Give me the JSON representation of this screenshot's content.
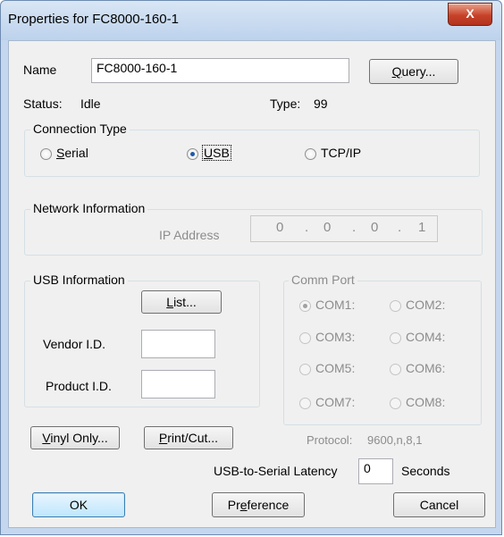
{
  "window": {
    "title": "Properties for FC8000-160-1",
    "close_label": "X"
  },
  "name": {
    "label": "Name",
    "value": "FC8000-160-1",
    "query_button": "Query..."
  },
  "status": {
    "label": "Status:",
    "value": "Idle",
    "type_label": "Type:",
    "type_value": "99"
  },
  "connection_type": {
    "title": "Connection Type",
    "options": [
      {
        "label": "Serial",
        "selected": false
      },
      {
        "label": "USB",
        "selected": true
      },
      {
        "label": "TCP/IP",
        "selected": false
      }
    ]
  },
  "network": {
    "title": "Network Information",
    "ip_label": "IP Address",
    "ip_octets": [
      "0",
      "0",
      "0",
      "1"
    ]
  },
  "usb": {
    "title": "USB Information",
    "list_button": "List...",
    "vendor_label": "Vendor I.D.",
    "vendor_value": "",
    "product_label": "Product I.D.",
    "product_value": ""
  },
  "comm_port": {
    "title": "Comm Port",
    "ports": [
      {
        "label": "COM1:",
        "selected": true
      },
      {
        "label": "COM2:",
        "selected": false
      },
      {
        "label": "COM3:",
        "selected": false
      },
      {
        "label": "COM4:",
        "selected": false
      },
      {
        "label": "COM5:",
        "selected": false
      },
      {
        "label": "COM6:",
        "selected": false
      },
      {
        "label": "COM7:",
        "selected": false
      },
      {
        "label": "COM8:",
        "selected": false
      }
    ]
  },
  "buttons": {
    "vinyl_only": "Vinyl Only...",
    "print_cut": "Print/Cut...",
    "ok": "OK",
    "preference": "Preference",
    "cancel": "Cancel"
  },
  "protocol": {
    "label": "Protocol:",
    "value": "9600,n,8,1"
  },
  "latency": {
    "label": "USB-to-Serial Latency",
    "value": "0",
    "unit": "Seconds"
  }
}
